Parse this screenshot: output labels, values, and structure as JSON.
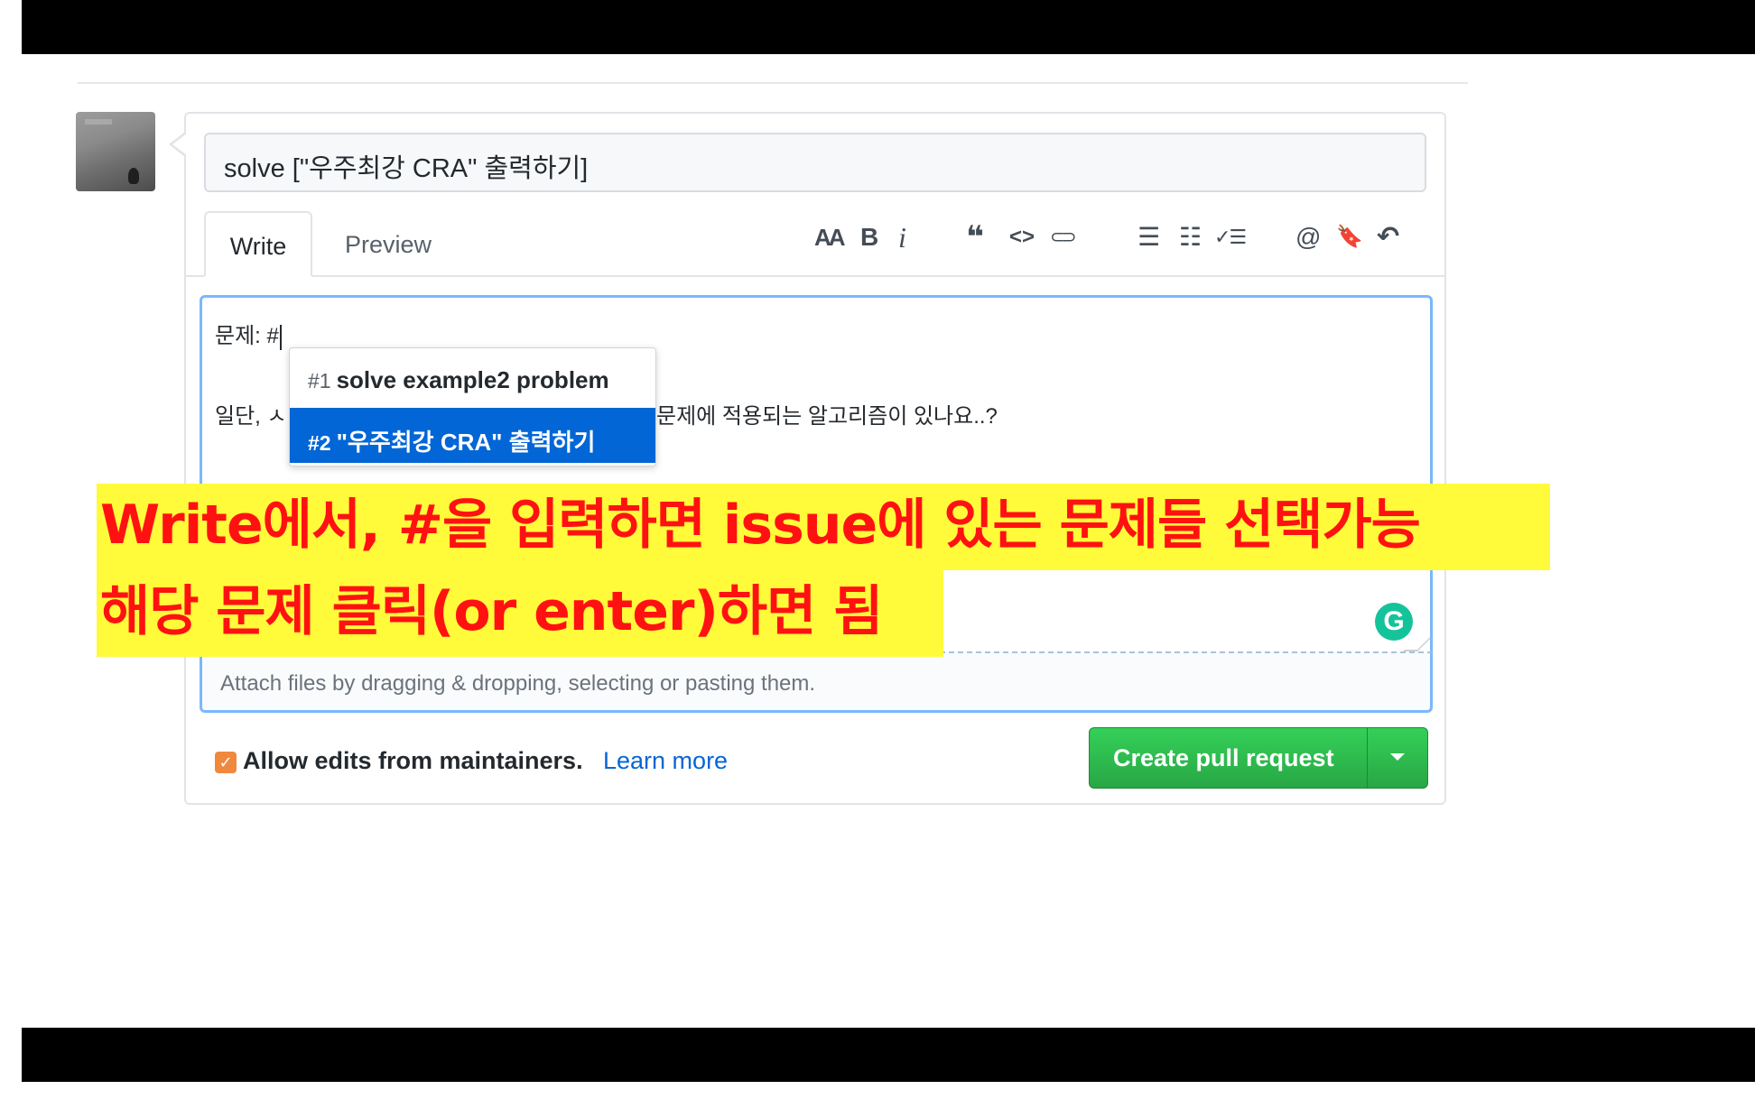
{
  "pr": {
    "title_value": "solve [\"우주최강 CRA\" 출력하기]",
    "tabs": {
      "write": "Write",
      "preview": "Preview"
    },
    "toolbar": {
      "header": "AA",
      "bold": "B",
      "italic": "i",
      "quote": "❝",
      "code": "<>",
      "link": "⊂⊃",
      "bulleted_list": "☰",
      "numbered_list": "☷",
      "task_list": "✓☰",
      "mention": "@",
      "reference": "🔖",
      "reply": "↶"
    },
    "body": {
      "line1": "문제: #",
      "line2_start": "일단, ㅅ",
      "line2_end": "문제에 적용되는 알고리즘이 있나요..?"
    },
    "autocomplete": [
      {
        "num": "#1",
        "title": "solve example2 problem",
        "selected": false
      },
      {
        "num": "#2",
        "title": "\"우주최강 CRA\" 출력하기",
        "selected": true
      }
    ],
    "attach_hint": "Attach files by dragging & dropping, selecting or pasting them.",
    "allow_edits_label": "Allow edits from maintainers.",
    "allow_edits_checked": true,
    "learn_more": "Learn more",
    "create_button": "Create pull request",
    "grammarly_letter": "G"
  },
  "annotation": {
    "line1": "Write에서, #을 입력하면 issue에 있는 문제들 선택가능",
    "line2": "해당 문제 클릭(or enter)하면 됨"
  },
  "colors": {
    "annotation_text": "#ff1111",
    "annotation_bg": "#fffa3a",
    "button_green": "#2ea44f",
    "link_blue": "#0366d6",
    "selected_blue": "#0366d6"
  }
}
